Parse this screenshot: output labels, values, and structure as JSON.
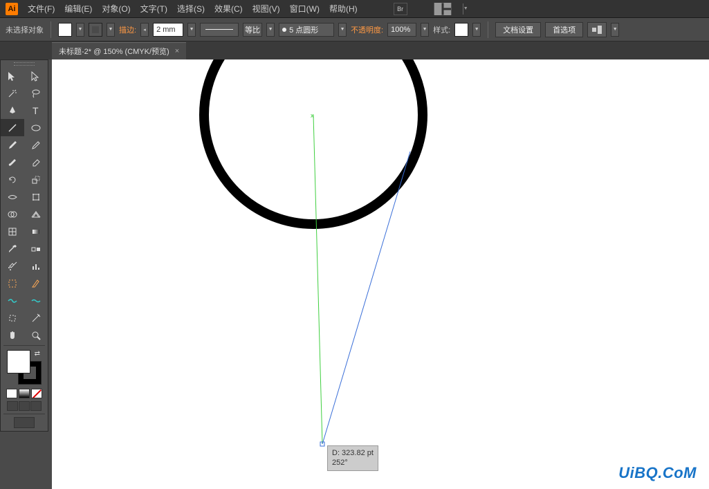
{
  "app": {
    "logo_text": "Ai"
  },
  "menu": {
    "file": "文件(F)",
    "edit": "编辑(E)",
    "object": "对象(O)",
    "type": "文字(T)",
    "select": "选择(S)",
    "effect": "效果(C)",
    "view": "视图(V)",
    "window": "窗口(W)",
    "help": "帮助(H)"
  },
  "menu_icons": {
    "br_label": "Br"
  },
  "control": {
    "no_selection": "未选择对象",
    "stroke_label": "描边:",
    "stroke_width": "2 mm",
    "profile_label": "等比",
    "brush_label": "5 点圆形",
    "opacity_label": "不透明度:",
    "opacity_value": "100%",
    "style_label": "样式:",
    "doc_setup": "文档设置",
    "preferences": "首选项"
  },
  "tab": {
    "title": "未标题-2* @ 150% (CMYK/预览)",
    "close": "×"
  },
  "canvas": {
    "measure_distance": "D: 323.82 pt",
    "measure_angle": "252°"
  },
  "watermark": "UiBQ.CoM",
  "tool_names": {
    "selection": "selection-tool",
    "direct_selection": "direct-selection-tool",
    "magic_wand": "magic-wand-tool",
    "lasso": "lasso-tool",
    "pen": "pen-tool",
    "type": "type-tool",
    "line": "line-segment-tool",
    "ellipse": "ellipse-tool",
    "paintbrush": "paintbrush-tool",
    "pencil": "pencil-tool",
    "blob_brush": "blob-brush-tool",
    "eraser": "eraser-tool",
    "rotate": "rotate-tool",
    "scale": "scale-tool",
    "width": "width-tool",
    "free_transform": "free-transform-tool",
    "shape_builder": "shape-builder-tool",
    "perspective": "perspective-grid-tool",
    "mesh": "mesh-tool",
    "gradient": "gradient-tool",
    "eyedropper": "eyedropper-tool",
    "blend": "blend-tool",
    "symbol_sprayer": "symbol-sprayer-tool",
    "column_graph": "column-graph-tool",
    "artboard": "artboard-tool",
    "slice": "slice-tool",
    "hand": "hand-tool",
    "zoom": "zoom-tool"
  }
}
